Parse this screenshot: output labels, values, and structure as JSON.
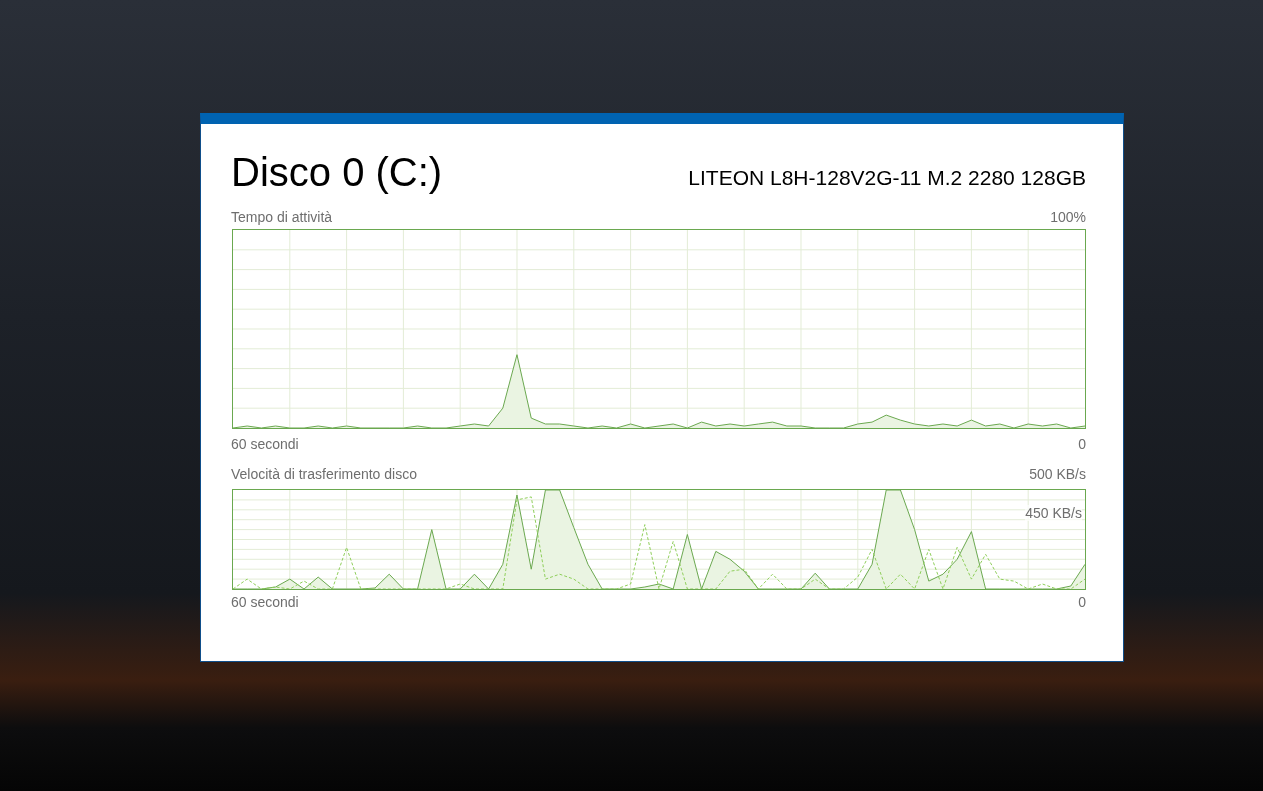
{
  "window": {
    "title": "Disco 0 (C:)",
    "model": "LITEON L8H-128V2G-11 M.2 2280 128GB"
  },
  "activity_graph": {
    "label": "Tempo di attività",
    "max_label": "100%",
    "time_label": "60 secondi",
    "min_label": "0"
  },
  "transfer_graph": {
    "label": "Velocità di trasferimento disco",
    "max_label": "500 KB/s",
    "marker_label": "450 KB/s",
    "time_label": "60 secondi",
    "min_label": "0"
  }
}
